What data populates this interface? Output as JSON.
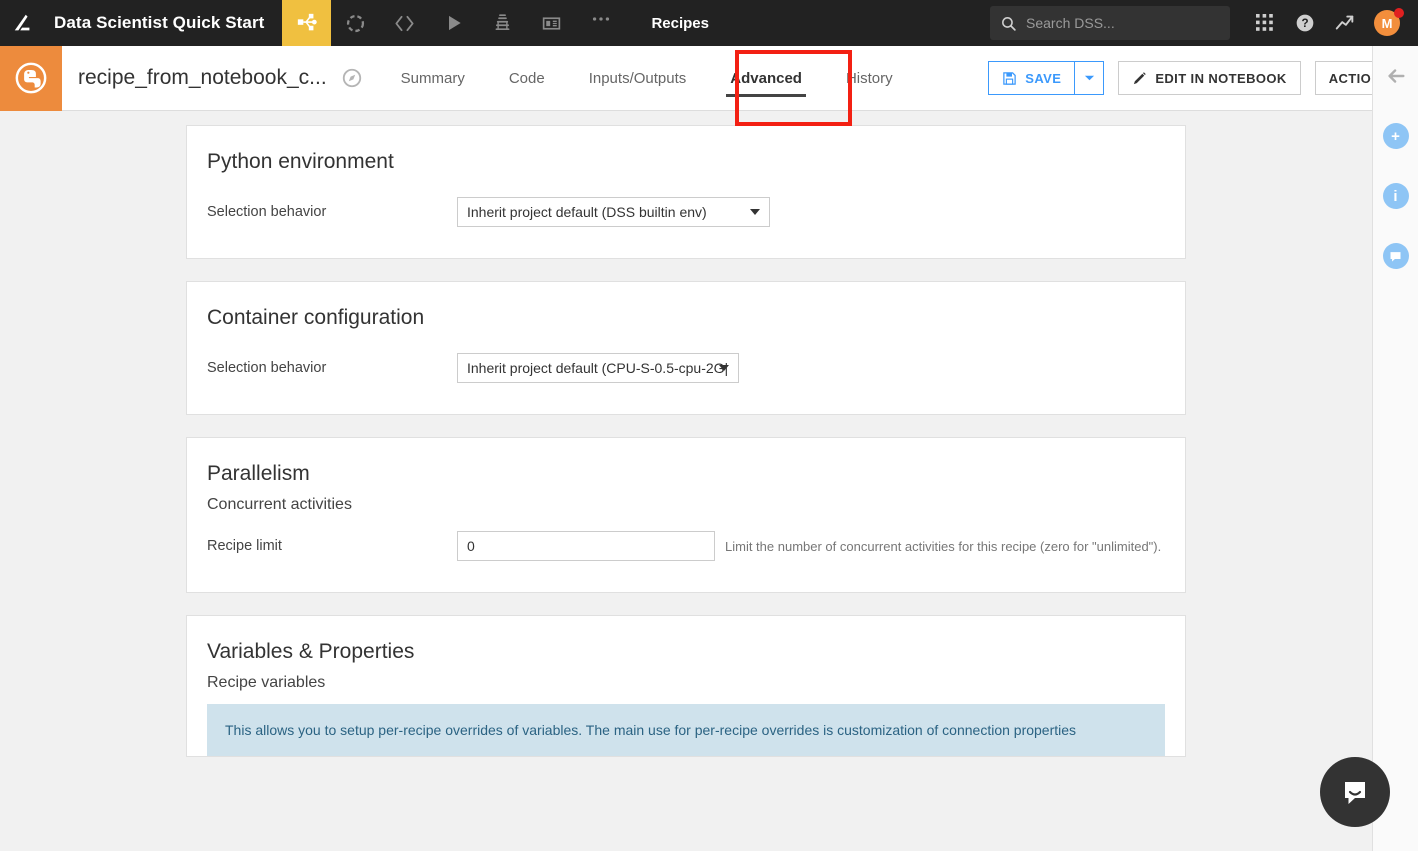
{
  "topbar": {
    "logo_icon": "dataiku-logo-icon",
    "project_name": "Data Scientist Quick Start",
    "nav_items": [
      {
        "icon": "flow-icon",
        "label": "Flow",
        "active": true
      },
      {
        "icon": "dataset-icon",
        "label": "Datasets",
        "active": false
      },
      {
        "icon": "code-icon",
        "label": "Code",
        "active": false
      },
      {
        "icon": "play-icon",
        "label": "Jobs",
        "active": false
      },
      {
        "icon": "lab-icon",
        "label": "Lab",
        "active": false
      },
      {
        "icon": "dashboard-icon",
        "label": "Dashboards",
        "active": false
      },
      {
        "icon": "more-icon",
        "label": "More",
        "active": false
      }
    ],
    "section_label": "Recipes",
    "search": {
      "icon": "search-icon",
      "placeholder": "Search DSS..."
    },
    "apps_icon": "apps-grid-icon",
    "help_icon": "help-circle-icon",
    "trending_icon": "trending-up-icon",
    "avatar_initial": "M",
    "notification_dot": true
  },
  "toolbar": {
    "recipe_icon": "python-recipe-icon",
    "recipe_name": "recipe_from_notebook_c...",
    "compass_icon": "compass-icon",
    "tabs": [
      {
        "label": "Summary",
        "active": false
      },
      {
        "label": "Code",
        "active": false
      },
      {
        "label": "Inputs/Outputs",
        "active": false
      },
      {
        "label": "Advanced",
        "active": true
      },
      {
        "label": "History",
        "active": false
      }
    ],
    "save_label": "SAVE",
    "save_icon": "floppy-disk-icon",
    "save_caret_icon": "chevron-down-icon",
    "edit_label": "EDIT IN NOTEBOOK",
    "edit_icon": "pencil-icon",
    "actions_label": "ACTIONS",
    "highlight_color": "#f32013",
    "accent_color": "#3b99fc"
  },
  "panels": {
    "python_env": {
      "title": "Python environment",
      "label": "Selection behavior",
      "value": "Inherit project default (DSS builtin env)"
    },
    "container": {
      "title": "Container configuration",
      "label": "Selection behavior",
      "value": "Inherit project default (CPU-S-0.5-cpu-2G|"
    },
    "parallelism": {
      "title": "Parallelism",
      "subhead": "Concurrent activities",
      "label": "Recipe limit",
      "value": "0",
      "help": "Limit the number of concurrent activities for this recipe (zero for \"unlimited\")."
    },
    "variables": {
      "title": "Variables & Properties",
      "subhead": "Recipe variables",
      "info": "This allows you to setup per-recipe overrides of variables. The main use for per-recipe overrides is customization of connection properties"
    }
  },
  "rail": {
    "items": [
      {
        "icon": "collapse-left-arrow-icon",
        "glyph": "←",
        "style": "plain"
      },
      {
        "icon": "add-circle-icon",
        "glyph": "+",
        "style": "circle"
      },
      {
        "icon": "info-circle-icon",
        "glyph": "i",
        "style": "circle"
      },
      {
        "icon": "comment-circle-icon",
        "glyph": "",
        "style": "circle"
      }
    ]
  },
  "intercom": {
    "icon": "intercom-chat-icon"
  }
}
